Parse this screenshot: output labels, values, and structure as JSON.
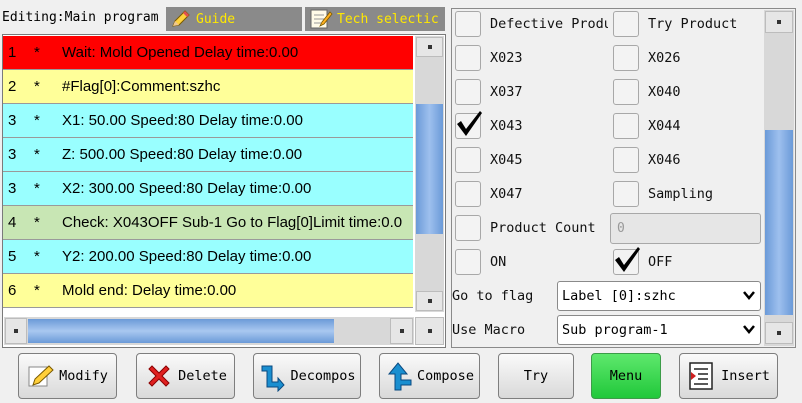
{
  "header": {
    "editing_label": "Editing:Main program",
    "guide_tab": "Guide",
    "tech_tab": "Tech selectic"
  },
  "program_rows": [
    {
      "num": "1",
      "star": "*",
      "text": "Wait: Mold Opened Delay time:0.00",
      "bg": "#ff0000",
      "fg": "#000000"
    },
    {
      "num": "2",
      "star": "*",
      "text": "#Flag[0]:Comment:szhc",
      "bg": "#ffff99",
      "fg": "#000000"
    },
    {
      "num": "3",
      "star": "*",
      "text": "X1: 50.00 Speed:80  Delay time:0.00",
      "bg": "#99ffff",
      "fg": "#000000"
    },
    {
      "num": "3",
      "star": "*",
      "text": "Z: 500.00 Speed:80  Delay time:0.00",
      "bg": "#99ffff",
      "fg": "#000000"
    },
    {
      "num": "3",
      "star": "*",
      "text": "X2: 300.00 Speed:80  Delay time:0.00",
      "bg": "#99ffff",
      "fg": "#000000"
    },
    {
      "num": "4",
      "star": "*",
      "text": "Check: X043OFF Sub-1 Go to Flag[0]Limit time:0.0",
      "bg": "#c8e6b4",
      "fg": "#000000"
    },
    {
      "num": "5",
      "star": "*",
      "text": "Y2: 200.00 Speed:80  Delay time:0.00",
      "bg": "#99ffff",
      "fg": "#000000"
    },
    {
      "num": "6",
      "star": "*",
      "text": "Mold end:  Delay time:0.00",
      "bg": "#ffff99",
      "fg": "#000000"
    }
  ],
  "list_scroll": {
    "vertical_fraction": 0.45,
    "horizontal_fraction": 0.85
  },
  "checks": {
    "defective_product": {
      "label": "Defective Product",
      "checked": false
    },
    "try_product": {
      "label": "Try Product",
      "checked": false
    },
    "x023": {
      "label": "X023",
      "checked": false
    },
    "x026": {
      "label": "X026",
      "checked": false
    },
    "x037": {
      "label": "X037",
      "checked": false
    },
    "x040": {
      "label": "X040",
      "checked": false
    },
    "x043": {
      "label": "X043",
      "checked": true
    },
    "x044": {
      "label": "X044",
      "checked": false
    },
    "x045": {
      "label": "X045",
      "checked": false
    },
    "x046": {
      "label": "X046",
      "checked": false
    },
    "x047": {
      "label": "X047",
      "checked": false
    },
    "sampling": {
      "label": "Sampling",
      "checked": false
    },
    "product_count": {
      "label": "Product Count",
      "checked": false
    },
    "on": {
      "label": "ON",
      "checked": false
    },
    "off": {
      "label": "OFF",
      "checked": true
    }
  },
  "product_count_value": "0",
  "goto_flag": {
    "label": "Go to flag",
    "value": "Label [0]:szhc"
  },
  "use_macro": {
    "label": "Use Macro",
    "value": "Sub program-1"
  },
  "buttons": {
    "modify": "Modify",
    "delete": "Delete",
    "decompose": "Decompos",
    "compose": "Compose",
    "try": "Try",
    "menu": "Menu",
    "insert": "Insert"
  },
  "colors": {
    "menu_button": "#2ecc40",
    "guide_text": "#ffe800",
    "check_mark": "#000000"
  }
}
